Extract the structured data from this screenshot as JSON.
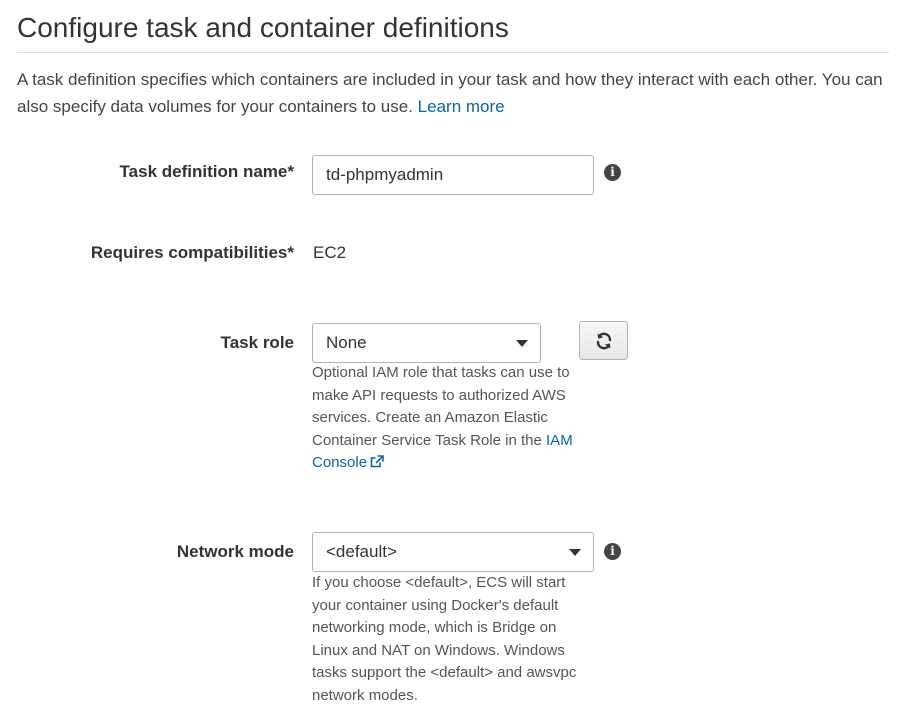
{
  "header": {
    "title": "Configure task and container definitions"
  },
  "intro": {
    "text": "A task definition specifies which containers are included in your task and how they interact with each other. You can also specify data volumes for your containers to use.",
    "learn_more": "Learn more"
  },
  "form": {
    "task_definition_name": {
      "label": "Task definition name*",
      "value": "td-phpmyadmin",
      "info_icon": "info-icon"
    },
    "requires_compatibilities": {
      "label": "Requires compatibilities*",
      "value": "EC2"
    },
    "task_role": {
      "label": "Task role",
      "selected": "None",
      "refresh_icon": "refresh-icon",
      "help_text": "Optional IAM role that tasks can use to make API requests to authorized AWS services. Create an Amazon Elastic Container Service Task Role in the",
      "help_link": "IAM Console",
      "help_link_icon": "external-link-icon"
    },
    "network_mode": {
      "label": "Network mode",
      "selected": "<default>",
      "info_icon": "info-icon",
      "help_text": "If you choose <default>, ECS will start your container using Docker's default networking mode, which is Bridge on Linux and NAT on Windows. Windows tasks support the <default> and awsvpc network modes."
    }
  },
  "colors": {
    "link": "#0b63ab",
    "border": "#aab7b8",
    "label": "#333333",
    "help_text": "#555555"
  }
}
